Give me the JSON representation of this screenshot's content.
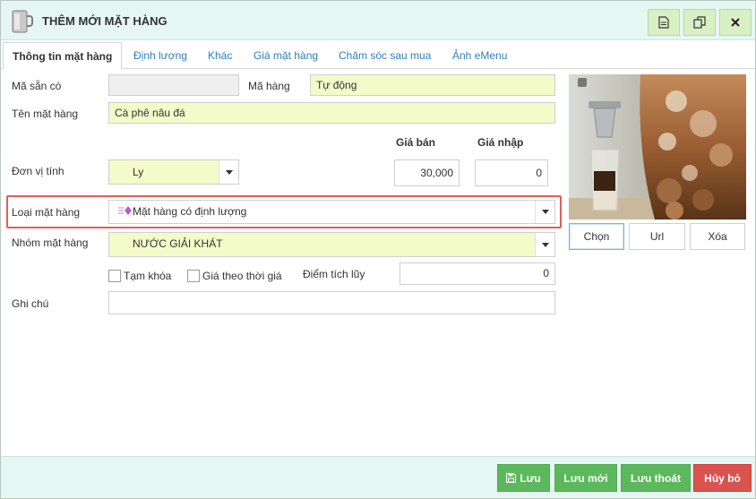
{
  "window": {
    "title": "THÊM MỚI MẶT HÀNG"
  },
  "tabs": [
    {
      "label": "Thông tin mặt hàng"
    },
    {
      "label": "Định lượng"
    },
    {
      "label": "Khác"
    },
    {
      "label": "Giá mặt hàng"
    },
    {
      "label": "Chăm sóc sau mua"
    },
    {
      "label": "Ảnh eMenu"
    }
  ],
  "form": {
    "existing_code_label": "Mã sẵn có",
    "existing_code_value": "",
    "item_code_label": "Mã hàng",
    "item_code_value": "Tự động",
    "item_name_label": "Tên mặt hàng",
    "item_name_value": "Cà phê nâu đá",
    "sale_price_label": "Giá bán",
    "purchase_price_label": "Giá nhập",
    "unit_label": "Đơn vị tính",
    "unit_value": "Ly",
    "sale_price_value": "30,000",
    "purchase_price_value": "0",
    "item_type_label": "Loại mặt hàng",
    "item_type_value": "Mặt hàng có định lượng",
    "item_group_label": "Nhóm mặt hàng",
    "item_group_value": "NƯỚC GIẢI KHÁT",
    "suspend_label": "Tạm khóa",
    "time_price_label": "Giá theo thời giá",
    "points_label": "Điểm tích lũy",
    "points_value": "0",
    "note_label": "Ghi chú",
    "note_value": ""
  },
  "image": {
    "choose_label": "Chọn",
    "url_label": "Url",
    "delete_label": "Xóa"
  },
  "footer": {
    "save_label": "Lưu",
    "save_new_label": "Lưu mới",
    "save_exit_label": "Lưu thoát",
    "cancel_label": "Hủy bỏ"
  },
  "icons": [
    "doc-icon",
    "copy-icon",
    "close-icon",
    "save-icon",
    "item-type-icon",
    "chevron-down-icon"
  ],
  "colors": {
    "green": "#5cb85c",
    "red": "#d9534f",
    "highlight": "#e35d5d",
    "field_yellow": "#f3fbc8",
    "link_blue": "#2f7fc0"
  }
}
